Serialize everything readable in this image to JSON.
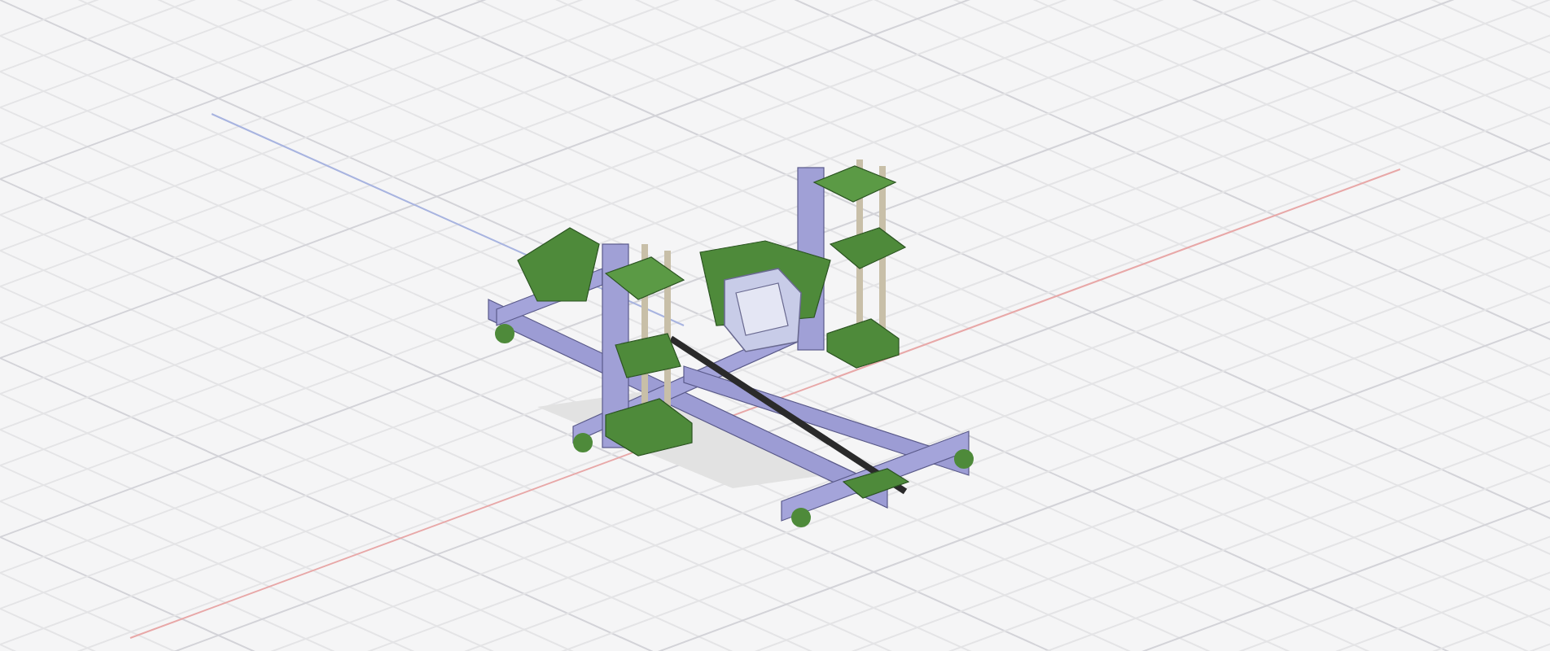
{
  "viewport": {
    "grid": true,
    "axes": true,
    "model": true
  }
}
